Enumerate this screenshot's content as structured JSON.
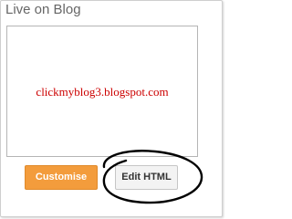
{
  "widget": {
    "title": "Live on Blog"
  },
  "preview": {
    "watermark_text": "clickmyblog3.blogspot.com"
  },
  "buttons": {
    "customise_label": "Customise",
    "edit_html_label": "Edit HTML"
  },
  "colors": {
    "customise_bg": "#f39c3c",
    "watermark_red": "#cc0000",
    "title_gray": "#666666",
    "annotation_ink": "#000000"
  }
}
